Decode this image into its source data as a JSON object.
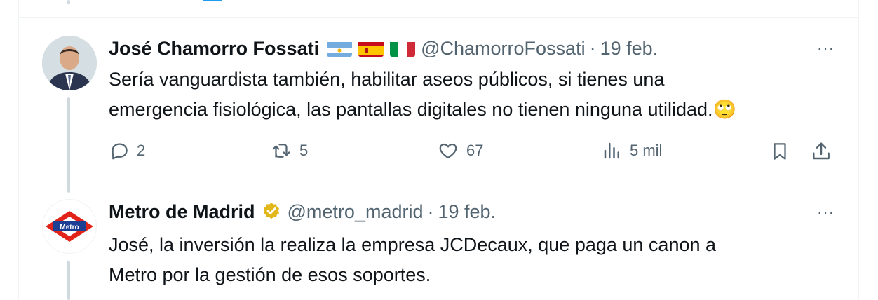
{
  "tweets": [
    {
      "author_name": "José Chamorro Fossati",
      "flags": [
        "argentina-flag",
        "spain-flag",
        "italy-flag"
      ],
      "handle": "@ChamorroFossati",
      "separator": "·",
      "date": "19 feb.",
      "text_line1": "Sería vanguardista también, habilitar aseos públicos, si tienes una",
      "text_line2": "emergencia fisiológica, las pantallas digitales no tienen ninguna utilidad.",
      "emoji": "🙄",
      "more": "···",
      "actions": {
        "reply_count": "2",
        "retweet_count": "5",
        "like_count": "67",
        "views_count": "5 mil"
      }
    },
    {
      "author_name": "Metro de Madrid",
      "verified": true,
      "handle": "@metro_madrid",
      "separator": "·",
      "date": "19 feb.",
      "text_line1": "José, la inversión la realiza la empresa JCDecaux, que paga un canon a",
      "text_line2": "Metro por la gestión de esos soportes.",
      "more": "···",
      "logo_text": "Metro"
    }
  ],
  "colors": {
    "text": "#0f1419",
    "secondary": "#536471",
    "accent": "#1d9bf0",
    "metro_red": "#e2231a",
    "metro_blue": "#1c3f94",
    "verified_gold": "#e2b719"
  }
}
